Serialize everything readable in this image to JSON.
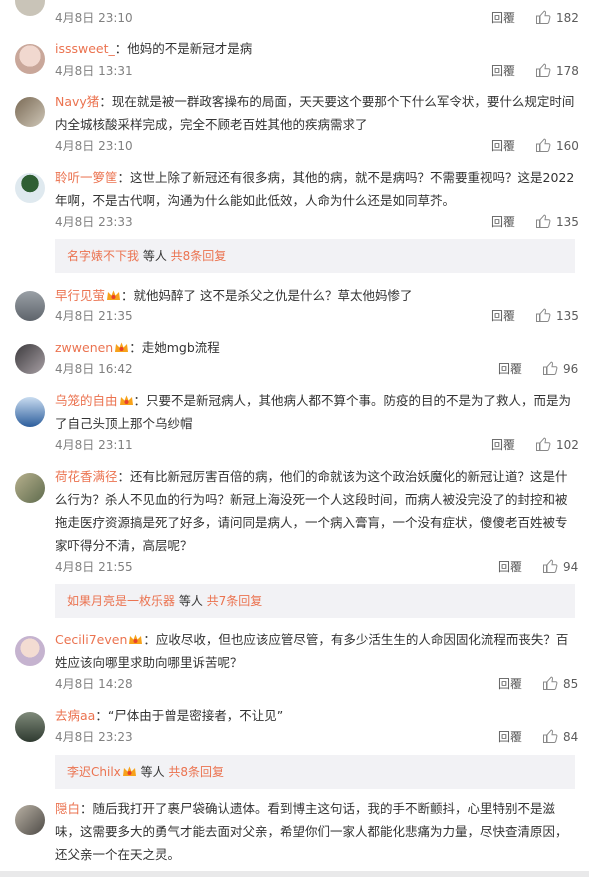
{
  "comments": [
    {
      "name": "",
      "text": "",
      "date": "4月8日 23:10",
      "reply": "回覆",
      "likes": "182"
    },
    {
      "name": "isssweet_",
      "text": "：他妈的不是新冠才是病",
      "date": "4月8日 13:31",
      "reply": "回覆",
      "likes": "178"
    },
    {
      "name": "Navy猪",
      "text": "：现在就是被一群政客操布的局面，天天要这个要那个下什么军令状，要什么规定时间内全城核酸采样完成，完全不顾老百姓其他的疾病需求了",
      "date": "4月8日 23:10",
      "reply": "回覆",
      "likes": "160"
    },
    {
      "name": "聆听一箩筐",
      "text": "：这世上除了新冠还有很多病，其他的病，就不是病吗？不需要重视吗？这是2022年啊，不是古代啊，沟通为什么能如此低效，人命为什么还是如同草芥。",
      "date": "4月8日 23:33",
      "reply": "回覆",
      "likes": "135",
      "sub": {
        "name": "名字婊不下我",
        "mid": " 等人 ",
        "more": "共8条回复"
      }
    },
    {
      "name": "早行见萤",
      "text": "：就他妈醉了 这不是杀父之仇是什么？草太他妈惨了",
      "date": "4月8日 21:35",
      "reply": "回覆",
      "likes": "135"
    },
    {
      "name": "zwwenen",
      "text": "：走她mgb流程",
      "date": "4月8日 16:42",
      "reply": "回覆",
      "likes": "96"
    },
    {
      "name": "乌笼的自由",
      "text": "：只要不是新冠病人，其他病人都不算个事。防疫的目的不是为了救人，而是为了自己头顶上那个乌纱帽",
      "date": "4月8日 23:11",
      "reply": "回覆",
      "likes": "102"
    },
    {
      "name": "荷花香满径",
      "text": "：还有比新冠厉害百倍的病，他们的命就该为这个政治妖魔化的新冠让道？这是什么行为？杀人不见血的行为吗？新冠上海没死一个人这段时间，而病人被没完没了的封控和被拖走医疗资源搞是死了好多，请问同是病人，一个病入膏肓，一个没有症状，傻傻老百姓被专家吓得分不清，高层呢？",
      "date": "4月8日 21:55",
      "reply": "回覆",
      "likes": "94",
      "sub": {
        "name": "如果月亮是一枚乐器",
        "mid": " 等人 ",
        "more": "共7条回复"
      }
    },
    {
      "name": "Cecili7even",
      "text": "：应收尽收，但也应该应管尽管，有多少活生生的人命因固化流程而丧失？百姓应该向哪里求助向哪里诉苦呢？",
      "date": "4月8日 14:28",
      "reply": "回覆",
      "likes": "85"
    },
    {
      "name": "去病aa",
      "text": "：“尸体由于曾是密接者，不让见”",
      "date": "4月8日 23:23",
      "reply": "回覆",
      "likes": "84",
      "sub": {
        "name": "李迟Chilx",
        "mid": " 等人 ",
        "more": "共8条回复"
      }
    },
    {
      "name": "隠白",
      "text": "：随后我打开了裹尸袋确认遗体。看到博主这句话，我的手不断颤抖，心里特别不是滋味，这需要多大的勇气才能去面对父亲，希望你们一家人都能化悲痛为力量，尽快查清原因，还父亲一个在天之灵。",
      "date": "",
      "reply": "",
      "likes": ""
    }
  ],
  "colors": {
    "name": "#eb7350",
    "meta": "#808080",
    "subbg": "#f2f2f5"
  }
}
